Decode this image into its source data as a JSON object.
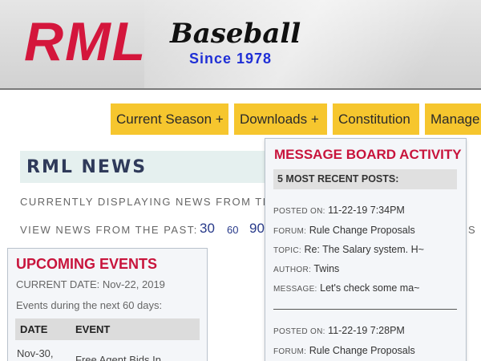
{
  "header": {
    "logo_main": "RML",
    "logo_sub": "Baseball",
    "logo_since": "Since 1978"
  },
  "nav": [
    {
      "label": "Current Season +"
    },
    {
      "label": "Downloads +"
    },
    {
      "label": "Constitution"
    },
    {
      "label": "Manage"
    }
  ],
  "news": {
    "title": "RML NEWS",
    "displaying": "CURRENTLY DISPLAYING NEWS FROM THE",
    "view_past_label": "VIEW NEWS FROM THE PAST:",
    "past_options": [
      "30",
      "60",
      "90"
    ],
    "trailing_text": "S"
  },
  "events": {
    "title": "UPCOMING EVENTS",
    "current_date": "CURRENT DATE: Nov-22, 2019",
    "range_text": "Events during the next 60 days:",
    "col_date": "DATE",
    "col_event": "EVENT",
    "rows": [
      {
        "date": "Nov-30,",
        "event": "Free Agent Bids In"
      }
    ]
  },
  "message_board": {
    "title": "MESSAGE BOARD ACTIVITY",
    "subtitle": "5 MOST RECENT POSTS:",
    "labels": {
      "posted_on": "POSTED ON:",
      "forum": "FORUM:",
      "topic": "TOPIC:",
      "author": "AUTHOR:",
      "message": "MESSAGE:"
    },
    "posts": [
      {
        "posted_on": "11-22-19 7:34PM",
        "forum": "Rule Change Proposals",
        "topic": "Re: The Salary system. H~",
        "author": "Twins",
        "message": "Let's check some ma~"
      },
      {
        "posted_on": "11-22-19 7:28PM",
        "forum": "Rule Change Proposals"
      }
    ]
  },
  "colors": {
    "brand_red": "#d4163c",
    "nav_yellow": "#f6c62e",
    "since_blue": "#1f2fd6",
    "heading_red": "#c8143c"
  }
}
